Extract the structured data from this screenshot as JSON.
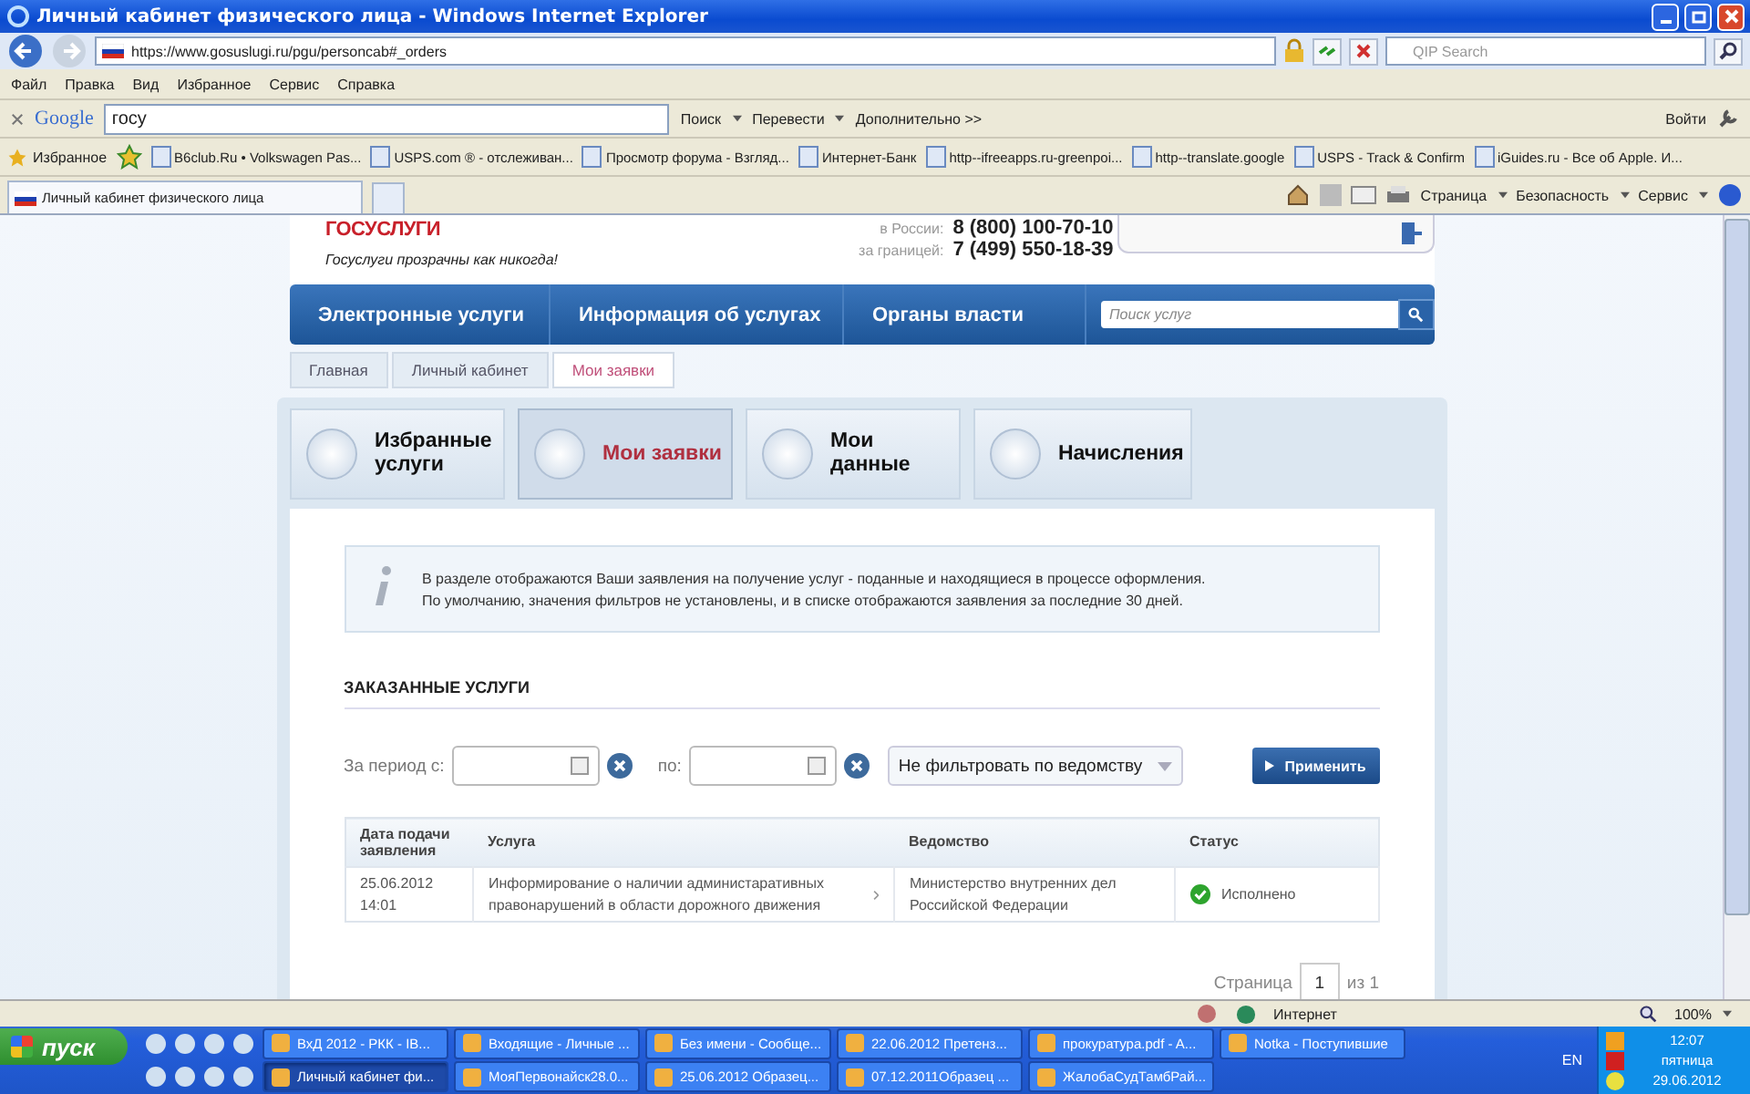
{
  "window": {
    "title": "Личный кабинет физического лица - Windows Internet Explorer"
  },
  "address": {
    "url": "https://www.gosuslugi.ru/pgu/personcab#_orders",
    "search_placeholder": "QIP Search"
  },
  "menu": [
    "Файл",
    "Правка",
    "Вид",
    "Избранное",
    "Сервис",
    "Справка"
  ],
  "google_bar": {
    "logo": "Google",
    "query": "госу",
    "search": "Поиск",
    "translate": "Перевести",
    "more": "Дополнительно >>",
    "login": "Войти"
  },
  "favorites": {
    "label": "Избранное",
    "links": [
      "B6club.Ru • Volkswagen Pas...",
      "USPS.com ® - отслеживан...",
      "Просмотр форума - Взгляд...",
      "Интернет-Банк",
      "http--ifreeapps.ru-greenpoi...",
      "http--translate.google",
      "USPS - Track & Confirm",
      "iGuides.ru - Все об Apple. И..."
    ]
  },
  "browser_tab": {
    "title": "Личный кабинет физического лица"
  },
  "command_bar": [
    "Страница",
    "Безопасность",
    "Сервис"
  ],
  "site": {
    "logo": "ГОСУСЛУГИ",
    "slogan": "Госуслуги прозрачны как никогда!",
    "phones": [
      {
        "label": "в России:",
        "number": "8 (800) 100-70-10"
      },
      {
        "label": "за границей:",
        "number": "7 (499) 550-18-39"
      }
    ],
    "nav": [
      "Электронные услуги",
      "Информация об услугах",
      "Органы власти"
    ],
    "search_placeholder": "Поиск услуг",
    "breadcrumbs": [
      {
        "label": "Главная",
        "selected": false
      },
      {
        "label": "Личный кабинет",
        "selected": false
      },
      {
        "label": "Мои заявки",
        "selected": true
      }
    ],
    "tabs": [
      {
        "label": "Избранные услуги",
        "selected": false
      },
      {
        "label": "Мои заявки",
        "selected": true
      },
      {
        "label": "Мои данные",
        "selected": false
      },
      {
        "label": "Начисления",
        "selected": false
      }
    ],
    "info": [
      "В разделе отображаются Ваши заявления на получение услуг - поданные и находящиеся в процессе оформления.",
      "По умолчанию, значения фильтров не установлены, и в списке отображаются заявления за последние 30 дней."
    ],
    "section_title": "ЗАКАЗАННЫЕ УСЛУГИ",
    "filter": {
      "from_label": "За период с:",
      "to_label": "по:",
      "agency": "Не фильтровать по ведомству",
      "apply": "Применить"
    },
    "table": {
      "columns": [
        "Дата подачи заявления",
        "Услуга",
        "Ведомство",
        "Статус"
      ],
      "rows": [
        {
          "date": "25.06.2012 14:01",
          "service": "Информирование о наличии администаративных правонарушений в области дорожного движения",
          "agency": "Министерство внутренних дел Российской Федерации",
          "status": {
            "kind": "done",
            "text": "Исполнено"
          }
        }
      ]
    },
    "pagination": {
      "label": "Страница",
      "page": "1",
      "total": "из 1"
    }
  },
  "status_bar": {
    "zone": "Интернет",
    "zoom": "100%"
  },
  "taskbar": {
    "start": "пуск",
    "tasks": [
      [
        {
          "label": "ВхД 2012 - РКК - IB...",
          "selected": false
        },
        {
          "label": "Входящие - Личные ...",
          "selected": false
        },
        {
          "label": "Без имени - Сообще...",
          "selected": false
        },
        {
          "label": "22.06.2012 Претенз...",
          "selected": false
        },
        {
          "label": "прокуратура.pdf - A...",
          "selected": false
        },
        {
          "label": "Notka - Поступившие",
          "selected": false
        }
      ],
      [
        {
          "label": "Личный кабинет фи...",
          "selected": true
        },
        {
          "label": "МояПервонайск28.0...",
          "selected": false
        },
        {
          "label": "25.06.2012 Образец...",
          "selected": false
        },
        {
          "label": "07.12.2011Образец ...",
          "selected": false
        },
        {
          "label": "ЖалобаСудТамбРай...",
          "selected": false
        }
      ]
    ],
    "lang": "EN",
    "time": "12:07",
    "day": "пятница",
    "date": "29.06.2012"
  }
}
